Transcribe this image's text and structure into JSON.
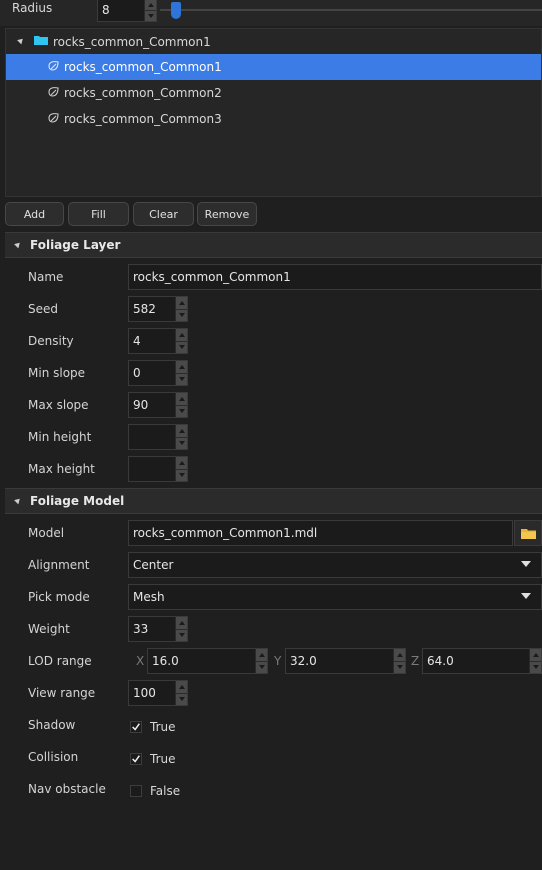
{
  "radius": {
    "label": "Radius",
    "value": "8",
    "slider_fraction": 0.03
  },
  "tree": {
    "root": "rocks_common_Common1",
    "items": [
      "rocks_common_Common1",
      "rocks_common_Common2",
      "rocks_common_Common3"
    ],
    "selected_index": 0
  },
  "buttons": {
    "add": "Add",
    "fill": "Fill",
    "clear": "Clear",
    "remove": "Remove"
  },
  "foliage_layer": {
    "title": "Foliage Layer",
    "name_label": "Name",
    "name_value": "rocks_common_Common1",
    "seed_label": "Seed",
    "seed_value": "582",
    "density_label": "Density",
    "density_value": "4",
    "min_slope_label": "Min slope",
    "min_slope_value": "0",
    "max_slope_label": "Max slope",
    "max_slope_value": "90",
    "min_height_label": "Min height",
    "min_height_value": "",
    "max_height_label": "Max height",
    "max_height_value": ""
  },
  "foliage_model": {
    "title": "Foliage Model",
    "model_label": "Model",
    "model_value": "rocks_common_Common1.mdl",
    "alignment_label": "Alignment",
    "alignment_value": "Center",
    "pick_mode_label": "Pick mode",
    "pick_mode_value": "Mesh",
    "weight_label": "Weight",
    "weight_value": "33",
    "lod_label": "LOD range",
    "lod_x_label": "X",
    "lod_x": "16.0",
    "lod_y_label": "Y",
    "lod_y": "32.0",
    "lod_z_label": "Z",
    "lod_z": "64.0",
    "view_range_label": "View range",
    "view_range_value": "100",
    "shadow_label": "Shadow",
    "shadow_value": "True",
    "shadow_checked": true,
    "collision_label": "Collision",
    "collision_value": "True",
    "collision_checked": true,
    "nav_label": "Nav obstacle",
    "nav_value": "False",
    "nav_checked": false
  },
  "colors": {
    "accent": "#3b7ce6",
    "folder": "#2ec6f0",
    "background": "#1f1f1f"
  }
}
